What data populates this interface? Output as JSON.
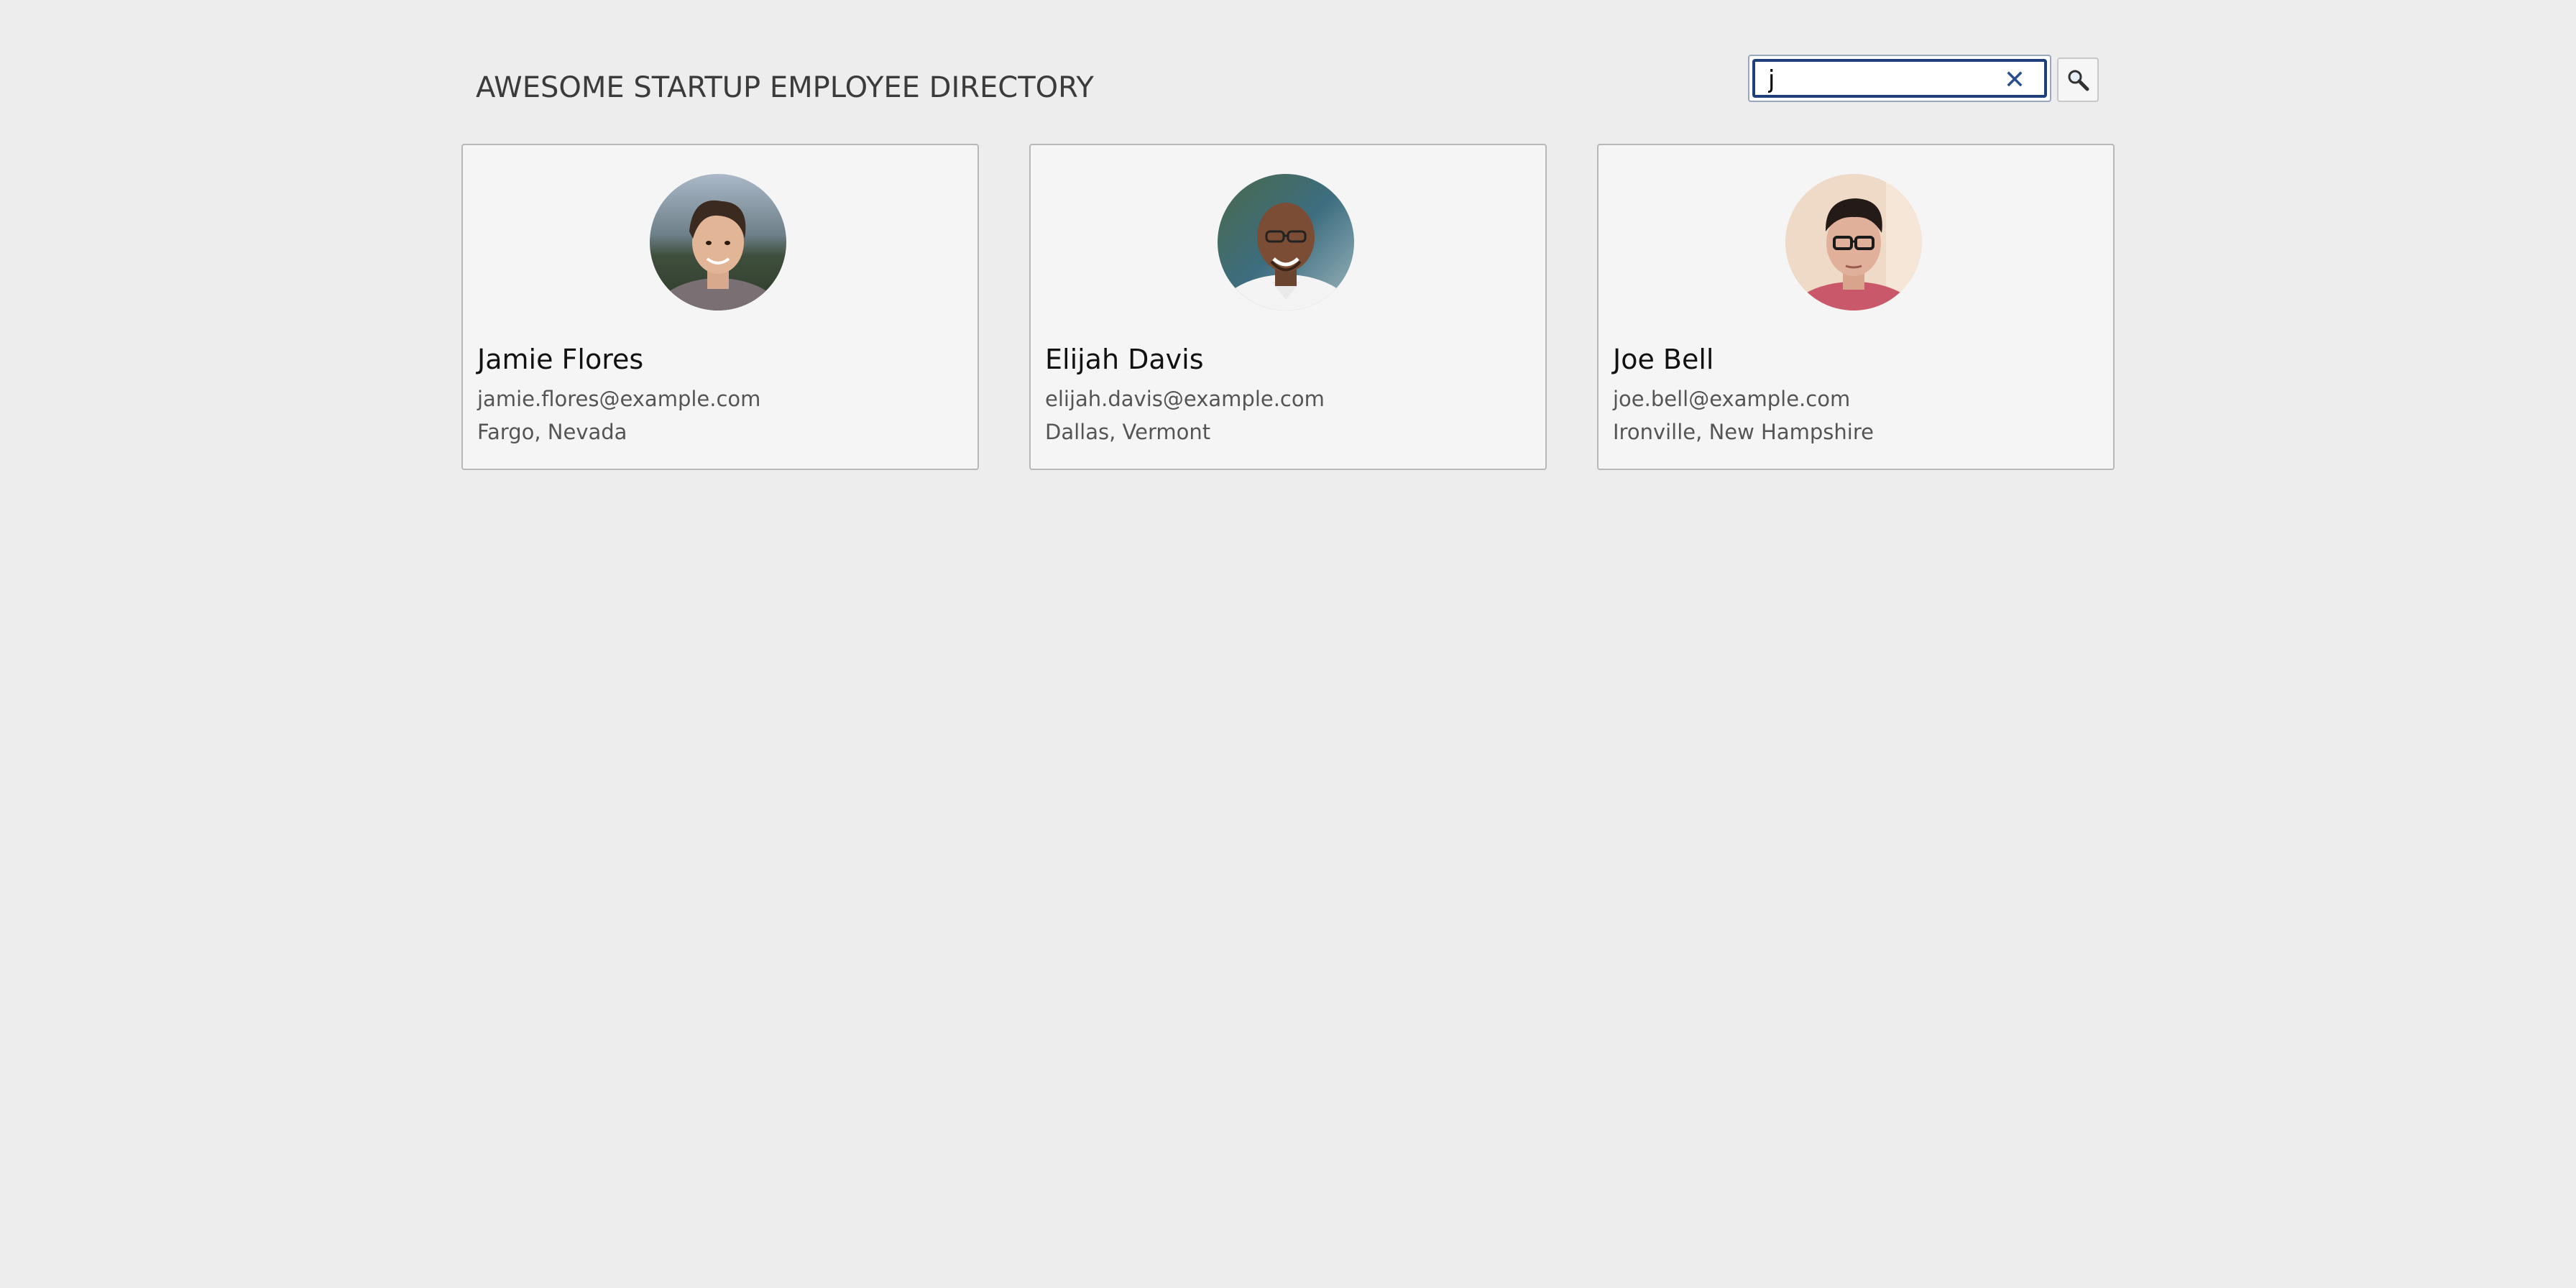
{
  "header": {
    "title": "AWESOME STARTUP EMPLOYEE DIRECTORY"
  },
  "search": {
    "value": "j",
    "placeholder": "",
    "clear_icon": "close-icon",
    "button_icon": "search-icon"
  },
  "employees": [
    {
      "name": "Jamie Flores",
      "email": "jamie.flores@example.com",
      "location": "Fargo, Nevada"
    },
    {
      "name": "Elijah Davis",
      "email": "elijah.davis@example.com",
      "location": "Dallas, Vermont"
    },
    {
      "name": "Joe Bell",
      "email": "joe.bell@example.com",
      "location": "Ironville, New Hampshire"
    }
  ],
  "colors": {
    "background": "#ededed",
    "card": "#f5f5f5",
    "focus_ring": "#1f3f7a",
    "clear_icon": "#2a4f8f"
  }
}
